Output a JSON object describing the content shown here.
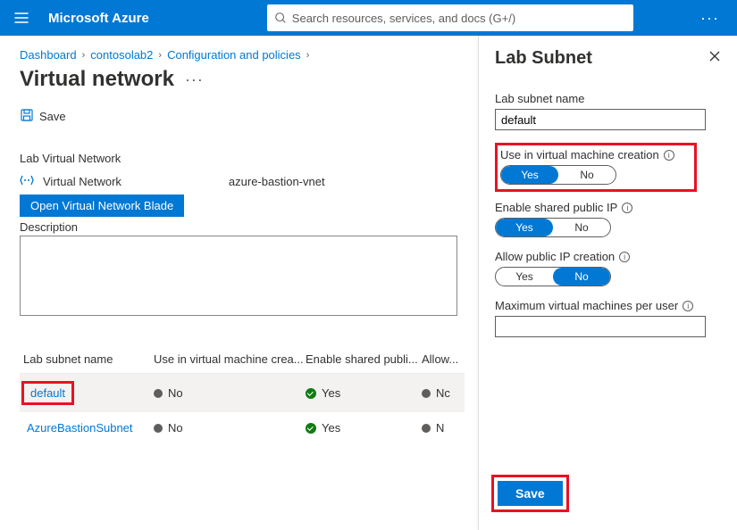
{
  "header": {
    "brand": "Microsoft Azure",
    "search_placeholder": "Search resources, services, and docs (G+/)"
  },
  "breadcrumbs": [
    "Dashboard",
    "contosolab2",
    "Configuration and policies"
  ],
  "page_title": "Virtual network",
  "commands": {
    "save": "Save"
  },
  "section": {
    "lab_vnet_label": "Lab Virtual Network",
    "vnet_field": "Virtual Network",
    "vnet_value": "azure-bastion-vnet",
    "open_blade": "Open Virtual Network Blade",
    "description_label": "Description",
    "description_value": ""
  },
  "table": {
    "headers": [
      "Lab subnet name",
      "Use in virtual machine crea...",
      "Enable shared publi...",
      "Allow..."
    ],
    "rows": [
      {
        "name": "default",
        "use": "No",
        "use_state": "gray",
        "shared": "Yes",
        "shared_state": "green",
        "allow": "Nc",
        "allow_state": "gray",
        "selected": true,
        "highlight": true
      },
      {
        "name": "AzureBastionSubnet",
        "use": "No",
        "use_state": "gray",
        "shared": "Yes",
        "shared_state": "green",
        "allow": "N",
        "allow_state": "gray",
        "selected": false,
        "highlight": false
      }
    ]
  },
  "panel": {
    "title": "Lab Subnet",
    "name_label": "Lab subnet name",
    "name_value": "default",
    "use_vm_label": "Use in virtual machine creation",
    "use_vm_value": "Yes",
    "shared_ip_label": "Enable shared public IP",
    "shared_ip_value": "Yes",
    "allow_ip_label": "Allow public IP creation",
    "allow_ip_value": "No",
    "max_vm_label": "Maximum virtual machines per user",
    "max_vm_value": "",
    "option_yes": "Yes",
    "option_no": "No",
    "save": "Save"
  }
}
